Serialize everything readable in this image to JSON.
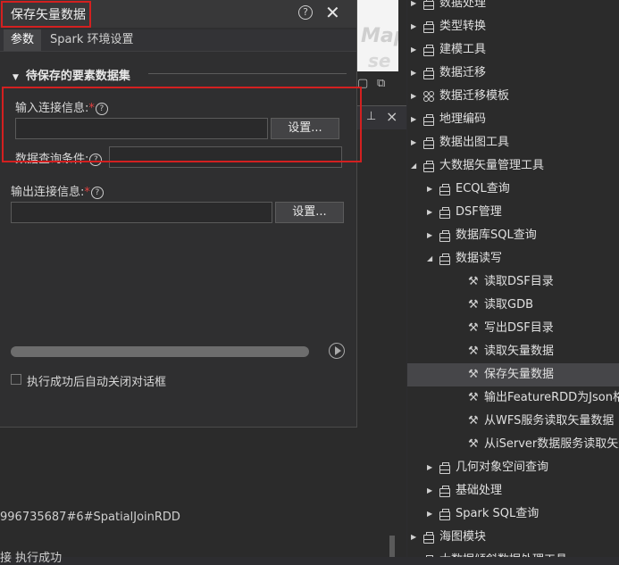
{
  "dialog": {
    "title": "保存矢量数据",
    "tabs": [
      "参数",
      "Spark 环境设置"
    ],
    "section_title": "待保存的要素数据集",
    "input_conn_label": "输入连接信息:",
    "required_mark": "*",
    "input_conn_value": "",
    "setup_button": "设置...",
    "query_label": "数据查询条件:",
    "query_value": "",
    "output_conn_label": "输出连接信息:",
    "output_conn_value": "",
    "progress": 0,
    "auto_close_label": "执行成功后自动关闭对话框",
    "auto_close_checked": false
  },
  "background": {
    "map_watermark_1": "Map",
    "map_watermark_2": "se",
    "log_lines": [
      "996735687#6#SpatialJoinRDD",
      "接 执行成功"
    ]
  },
  "tree": {
    "items": [
      {
        "label": "数据处理",
        "icon": "toolbox-icon"
      },
      {
        "label": "类型转换",
        "icon": "toolbox-icon"
      },
      {
        "label": "建模工具",
        "icon": "toolbox-icon"
      },
      {
        "label": "数据迁移",
        "icon": "toolbox-icon"
      },
      {
        "label": "数据迁移模板",
        "icon": "grid-icon"
      },
      {
        "label": "地理编码",
        "icon": "toolbox-icon"
      },
      {
        "label": "数据出图工具",
        "icon": "toolbox-icon"
      },
      {
        "label": "大数据矢量管理工具",
        "icon": "toolbox-icon"
      },
      {
        "label": "ECQL查询",
        "icon": "toolbox-icon"
      },
      {
        "label": "DSF管理",
        "icon": "toolbox-icon"
      },
      {
        "label": "数据库SQL查询",
        "icon": "toolbox-icon"
      },
      {
        "label": "数据读写",
        "icon": "toolbox-icon"
      },
      {
        "label": "读取DSF目录",
        "icon": "wrench-icon"
      },
      {
        "label": "读取GDB",
        "icon": "wrench-icon"
      },
      {
        "label": "写出DSF目录",
        "icon": "wrench-icon"
      },
      {
        "label": "读取矢量数据",
        "icon": "wrench-icon"
      },
      {
        "label": "保存矢量数据",
        "icon": "wrench-icon"
      },
      {
        "label": "输出FeatureRDD为Json格式",
        "icon": "wrench-icon"
      },
      {
        "label": "从WFS服务读取矢量数据",
        "icon": "wrench-icon"
      },
      {
        "label": "从iServer数据服务读取矢量数据",
        "icon": "wrench-icon"
      },
      {
        "label": "几何对象空间查询",
        "icon": "toolbox-icon"
      },
      {
        "label": "基础处理",
        "icon": "toolbox-icon"
      },
      {
        "label": "Spark SQL查询",
        "icon": "toolbox-icon"
      },
      {
        "label": "海图模块",
        "icon": "toolbox-icon"
      },
      {
        "label": "大数据倾斜数据处理工具",
        "icon": "toolbox-icon"
      }
    ]
  }
}
